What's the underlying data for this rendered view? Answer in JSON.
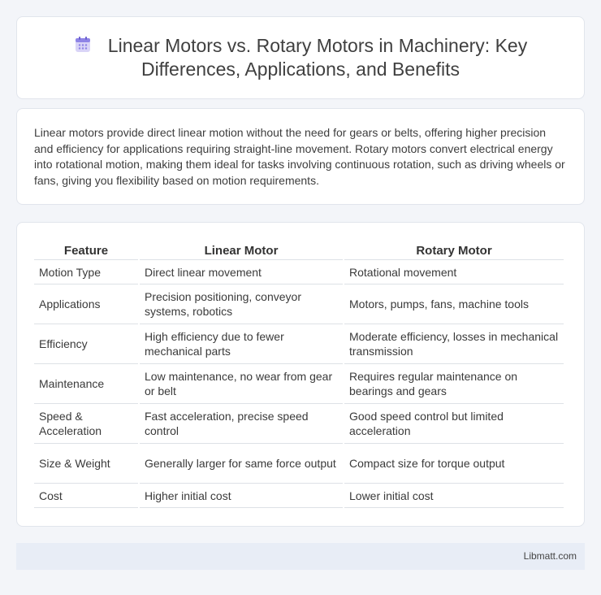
{
  "header": {
    "icon": "calendar-icon",
    "title": "Linear Motors vs. Rotary Motors in Machinery: Key Differences, Applications, and Benefits"
  },
  "intro": {
    "text": "Linear motors provide direct linear motion without the need for gears or belts, offering higher precision and efficiency for applications requiring straight-line movement. Rotary motors convert electrical energy into rotational motion, making them ideal for tasks involving continuous rotation, such as driving wheels or fans, giving you flexibility based on motion requirements."
  },
  "table": {
    "headers": [
      "Feature",
      "Linear Motor",
      "Rotary Motor"
    ],
    "rows": [
      [
        "Motion Type",
        "Direct linear movement",
        "Rotational movement"
      ],
      [
        "Applications",
        "Precision positioning, conveyor systems, robotics",
        "Motors, pumps, fans, machine tools"
      ],
      [
        "Efficiency",
        "High efficiency due to fewer mechanical parts",
        "Moderate efficiency, losses in mechanical transmission"
      ],
      [
        "Maintenance",
        "Low maintenance, no wear from gear or belt",
        "Requires regular maintenance on bearings and gears"
      ],
      [
        "Speed & Acceleration",
        "Fast acceleration, precise speed control",
        "Good speed control but limited acceleration"
      ],
      [
        "Size & Weight",
        "Generally larger for same force output",
        "Compact size for torque output"
      ],
      [
        "Cost",
        "Higher initial cost",
        "Lower initial cost"
      ]
    ]
  },
  "footer": {
    "text": "Libmatt.com"
  }
}
